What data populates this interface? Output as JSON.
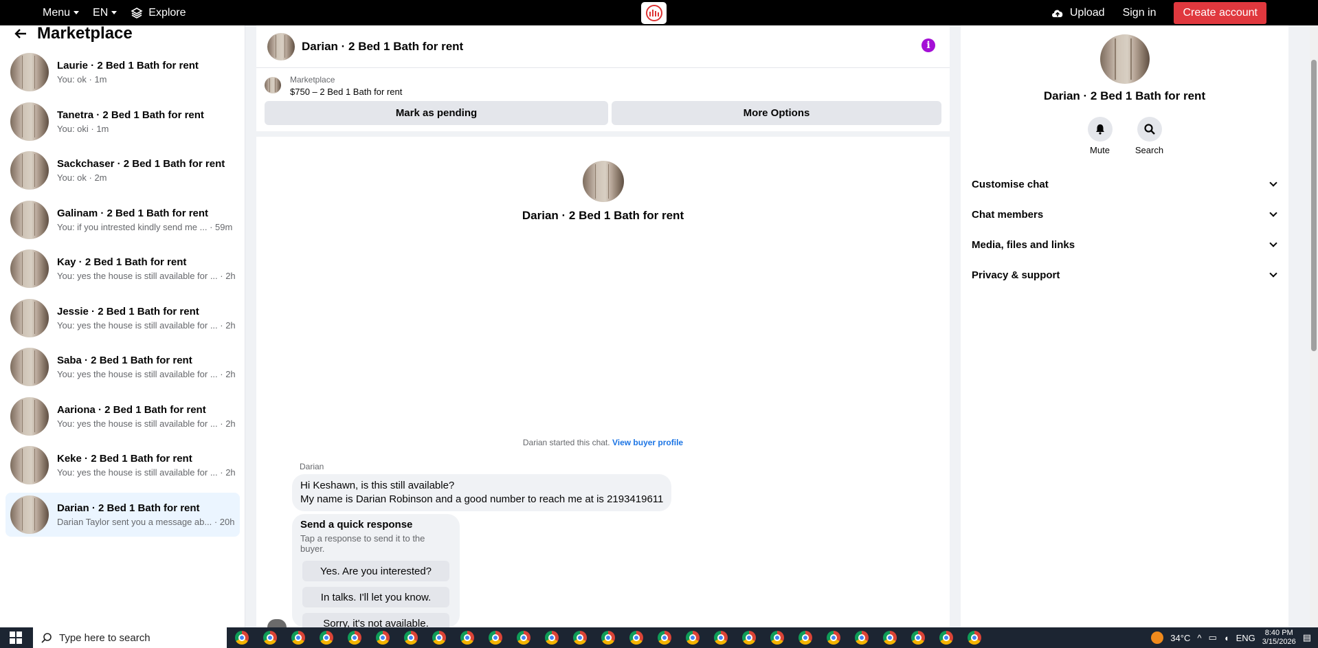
{
  "topbar": {
    "menu_label": "Menu",
    "lang_label": "EN",
    "explore_label": "Explore",
    "upload_label": "Upload",
    "signin_label": "Sign in",
    "create_account_label": "Create account"
  },
  "sidebar": {
    "title": "Marketplace",
    "conversations": [
      {
        "name": "Laurie · 2 Bed 1 Bath for rent",
        "preview": "You: ok · 1m",
        "active": false
      },
      {
        "name": "Tanetra · 2 Bed 1 Bath for rent",
        "preview": "You: oki · 1m",
        "active": false
      },
      {
        "name": "Sackchaser · 2 Bed 1 Bath for rent",
        "preview": "You: ok · 2m",
        "active": false
      },
      {
        "name": "Galinam · 2 Bed 1 Bath for rent",
        "preview": "You: if you intrested kindly send me ... · 59m",
        "active": false
      },
      {
        "name": "Kay · 2 Bed 1 Bath for rent",
        "preview": "You: yes the house is still available for ... · 2h",
        "active": false
      },
      {
        "name": "Jessie · 2 Bed 1 Bath for rent",
        "preview": "You: yes the house is still available for ... · 2h",
        "active": false
      },
      {
        "name": "Saba · 2 Bed 1 Bath for rent",
        "preview": "You: yes the house is still available for ... · 2h",
        "active": false
      },
      {
        "name": "Aariona · 2 Bed 1 Bath for rent",
        "preview": "You: yes the house is still available for ... · 2h",
        "active": false
      },
      {
        "name": "Keke · 2 Bed 1 Bath for rent",
        "preview": "You: yes the house is still available for ... · 2h",
        "active": false
      },
      {
        "name": "Darian · 2 Bed 1 Bath for rent",
        "preview": "Darian Taylor sent you a message ab... · 20h",
        "active": true
      }
    ]
  },
  "chat": {
    "title": "Darian · 2 Bed 1 Bath for rent",
    "listing_category": "Marketplace",
    "listing_price": "$750 – 2 Bed 1 Bath for rent",
    "mark_pending_label": "Mark as pending",
    "more_options_label": "More Options",
    "intro_name": "Darian · 2 Bed 1 Bath for rent",
    "started_text": "Darian started this chat.",
    "view_profile_label": "View buyer profile",
    "sender_name": "Darian",
    "message_line1": "Hi Keshawn, is this still available?",
    "message_line2": "My name is Darian Robinson and a good number to reach me at is 2193419611",
    "quick_title": "Send a quick response",
    "quick_subtitle": "Tap a response to send it to the buyer.",
    "quick_responses": [
      "Yes. Are you interested?",
      "In talks. I'll let you know.",
      "Sorry, it's not available."
    ]
  },
  "details": {
    "name": "Darian · 2 Bed 1 Bath for rent",
    "mute_label": "Mute",
    "search_label": "Search",
    "sections": [
      "Customise chat",
      "Chat members",
      "Media, files and links",
      "Privacy & support"
    ]
  },
  "taskbar": {
    "search_placeholder": "Type here to search",
    "temperature": "34°C",
    "language": "ENG",
    "time": "8:40 PM",
    "date": "3/15/2026"
  },
  "colors": {
    "accent_red": "#e0383e",
    "info_purple": "#a40fd6",
    "link_blue": "#1b74e4",
    "active_row": "#ebf5ff"
  }
}
